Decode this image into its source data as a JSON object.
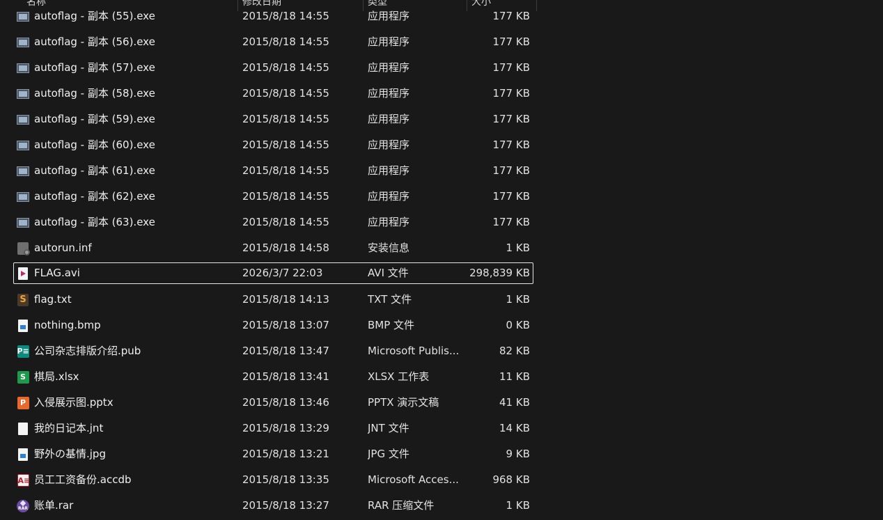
{
  "columns": {
    "name": "名称",
    "date": "修改日期",
    "type": "类型",
    "size": "大小"
  },
  "files": [
    {
      "name": "autoflag - 副本 (55).exe",
      "date": "2015/8/18 14:55",
      "type": "应用程序",
      "size": "177 KB",
      "icon": "exe-icon"
    },
    {
      "name": "autoflag - 副本 (56).exe",
      "date": "2015/8/18 14:55",
      "type": "应用程序",
      "size": "177 KB",
      "icon": "exe-icon"
    },
    {
      "name": "autoflag - 副本 (57).exe",
      "date": "2015/8/18 14:55",
      "type": "应用程序",
      "size": "177 KB",
      "icon": "exe-icon"
    },
    {
      "name": "autoflag - 副本 (58).exe",
      "date": "2015/8/18 14:55",
      "type": "应用程序",
      "size": "177 KB",
      "icon": "exe-icon"
    },
    {
      "name": "autoflag - 副本 (59).exe",
      "date": "2015/8/18 14:55",
      "type": "应用程序",
      "size": "177 KB",
      "icon": "exe-icon"
    },
    {
      "name": "autoflag - 副本 (60).exe",
      "date": "2015/8/18 14:55",
      "type": "应用程序",
      "size": "177 KB",
      "icon": "exe-icon"
    },
    {
      "name": "autoflag - 副本 (61).exe",
      "date": "2015/8/18 14:55",
      "type": "应用程序",
      "size": "177 KB",
      "icon": "exe-icon"
    },
    {
      "name": "autoflag - 副本 (62).exe",
      "date": "2015/8/18 14:55",
      "type": "应用程序",
      "size": "177 KB",
      "icon": "exe-icon"
    },
    {
      "name": "autoflag - 副本 (63).exe",
      "date": "2015/8/18 14:55",
      "type": "应用程序",
      "size": "177 KB",
      "icon": "exe-icon"
    },
    {
      "name": "autorun.inf",
      "date": "2015/8/18 14:58",
      "type": "安装信息",
      "size": "1 KB",
      "icon": "inf-settings-icon"
    },
    {
      "name": "FLAG.avi",
      "date": "2026/3/7 22:03",
      "type": "AVI 文件",
      "size": "298,839 KB",
      "icon": "video-file-icon",
      "selected": true
    },
    {
      "name": "flag.txt",
      "date": "2015/8/18 14:13",
      "type": "TXT 文件",
      "size": "1 KB",
      "icon": "text-file-icon"
    },
    {
      "name": "nothing.bmp",
      "date": "2015/8/18 13:07",
      "type": "BMP 文件",
      "size": "0 KB",
      "icon": "image-file-icon"
    },
    {
      "name": "公司杂志排版介绍.pub",
      "date": "2015/8/18 13:47",
      "type": "Microsoft Publis...",
      "size": "82 KB",
      "icon": "publisher-icon"
    },
    {
      "name": "棋局.xlsx",
      "date": "2015/8/18 13:41",
      "type": "XLSX 工作表",
      "size": "11 KB",
      "icon": "spreadsheet-icon"
    },
    {
      "name": "入侵展示图.pptx",
      "date": "2015/8/18 13:46",
      "type": "PPTX 演示文稿",
      "size": "41 KB",
      "icon": "presentation-icon"
    },
    {
      "name": "我的日记本.jnt",
      "date": "2015/8/18 13:29",
      "type": "JNT 文件",
      "size": "14 KB",
      "icon": "blank-file-icon"
    },
    {
      "name": "野外の基情.jpg",
      "date": "2015/8/18 13:21",
      "type": "JPG 文件",
      "size": "9 KB",
      "icon": "image-file-icon"
    },
    {
      "name": "员工工资备份.accdb",
      "date": "2015/8/18 13:35",
      "type": "Microsoft Acces...",
      "size": "968 KB",
      "icon": "access-database-icon"
    },
    {
      "name": "账单.rar",
      "date": "2015/8/18 13:27",
      "type": "RAR 压缩文件",
      "size": "1 KB",
      "icon": "rar-archive-icon"
    }
  ],
  "icon_labels": {
    "text": "S",
    "publisher": "P≡",
    "spreadsheet": "S",
    "presentation": "P",
    "access": "A≡",
    "rar": "RAR"
  }
}
